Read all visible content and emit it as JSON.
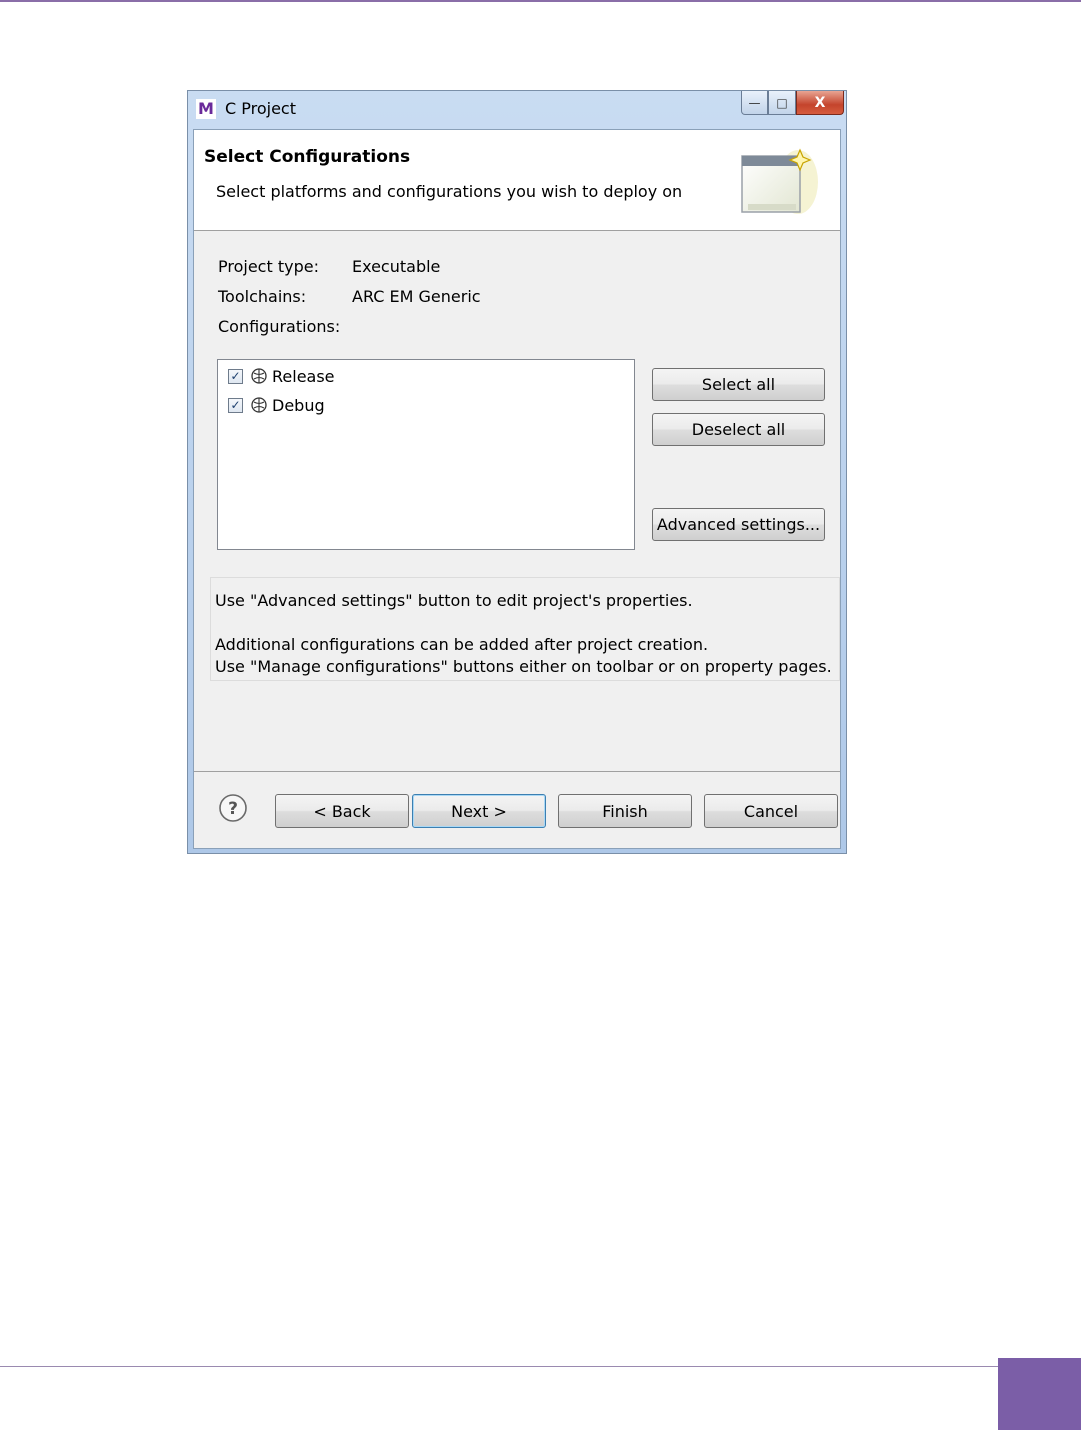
{
  "window": {
    "app_icon": "M",
    "title": "C Project",
    "controls": {
      "minimize": "—",
      "maximize": "□",
      "close": "X"
    }
  },
  "banner": {
    "title": "Select Configurations",
    "description": "Select platforms and configurations you wish to deploy on",
    "image_icon": "wizard-banner-icon"
  },
  "info": {
    "project_type_label": "Project type:",
    "project_type_value": "Executable",
    "toolchains_label": "Toolchains:",
    "toolchains_value": "ARC EM Generic",
    "configurations_label": "Configurations:"
  },
  "configurations": [
    {
      "label": "Release",
      "checked": true,
      "icon": "configuration-icon"
    },
    {
      "label": "Debug",
      "checked": true,
      "icon": "configuration-icon"
    }
  ],
  "side_buttons": {
    "select_all": "Select all",
    "deselect_all": "Deselect all",
    "advanced_settings": "Advanced settings..."
  },
  "hints": {
    "line1": "Use \"Advanced settings\" button to edit project's properties.",
    "line2": "Additional configurations can be added after project creation.",
    "line3": "Use \"Manage configurations\" buttons either on toolbar or on property pages."
  },
  "footer": {
    "help_icon": "help-icon",
    "back": "< Back",
    "next": "Next >",
    "finish": "Finish",
    "cancel": "Cancel"
  },
  "colors": {
    "page_accent": "#7b5ea7",
    "default_button_border": "#3c7fb1",
    "close_button": "#c4442c"
  }
}
